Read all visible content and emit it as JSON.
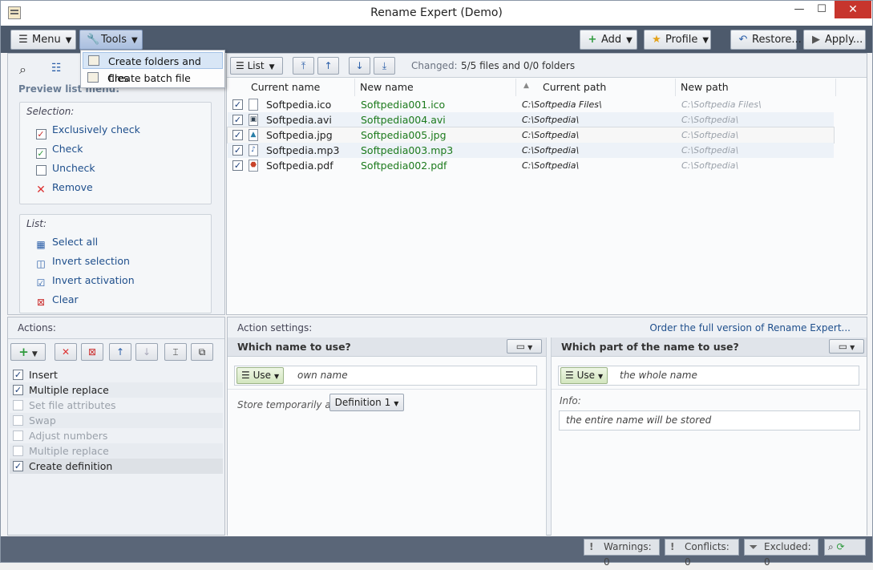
{
  "window": {
    "title": "Rename Expert (Demo)",
    "minimize": "—",
    "maximize": "☐",
    "close": "✕"
  },
  "toolbar": {
    "menu": "Menu",
    "tools": "Tools",
    "add": "Add",
    "profile": "Profile",
    "restore": "Restore...",
    "apply": "Apply..."
  },
  "tools_menu": {
    "items": [
      "Create folders and files",
      "Create batch file"
    ]
  },
  "sidebar": {
    "search_title": "Preview list menu:",
    "selection_label": "Selection:",
    "selection": [
      "Exclusively check",
      "Check",
      "Uncheck",
      "Remove"
    ],
    "list_label": "List:",
    "list": [
      "Select all",
      "Invert selection",
      "Invert activation",
      "Clear"
    ]
  },
  "preview": {
    "view": "List",
    "changed_label": "Changed:",
    "changed_value": "5/5 files and 0/0 folders",
    "columns": [
      "Current name",
      "New name",
      "Current path",
      "New path"
    ],
    "rows": [
      {
        "current": "Softpedia.ico",
        "new": "Softpedia001.ico",
        "path": "C:\\Softpedia Files\\",
        "new_path": "C:\\Softpedia Files\\",
        "icon": "file-icon"
      },
      {
        "current": "Softpedia.avi",
        "new": "Softpedia004.avi",
        "path": "C:\\Softpedia\\",
        "new_path": "C:\\Softpedia\\",
        "icon": "video-icon"
      },
      {
        "current": "Softpedia.jpg",
        "new": "Softpedia005.jpg",
        "path": "C:\\Softpedia\\",
        "new_path": "C:\\Softpedia\\",
        "icon": "image-icon"
      },
      {
        "current": "Softpedia.mp3",
        "new": "Softpedia003.mp3",
        "path": "C:\\Softpedia\\",
        "new_path": "C:\\Softpedia\\",
        "icon": "audio-icon"
      },
      {
        "current": "Softpedia.pdf",
        "new": "Softpedia002.pdf",
        "path": "C:\\Softpedia\\",
        "new_path": "C:\\Softpedia\\",
        "icon": "pdf-icon"
      }
    ]
  },
  "actions": {
    "title": "Actions:",
    "items": [
      {
        "label": "Insert",
        "checked": true,
        "enabled": true
      },
      {
        "label": "Multiple replace",
        "checked": true,
        "enabled": true
      },
      {
        "label": "Set file attributes",
        "checked": false,
        "enabled": false
      },
      {
        "label": "Swap",
        "checked": false,
        "enabled": false
      },
      {
        "label": "Adjust numbers",
        "checked": false,
        "enabled": false
      },
      {
        "label": "Multiple replace",
        "checked": false,
        "enabled": false
      },
      {
        "label": "Create definition",
        "checked": true,
        "enabled": true
      }
    ]
  },
  "settings": {
    "title": "Action settings:",
    "order_link": "Order the full version of Rename Expert...",
    "left": {
      "header": "Which name to use?",
      "use": "Use",
      "value": "own name",
      "store_label": "Store temporarily as:",
      "store_value": "Definition  1"
    },
    "right": {
      "header": "Which part of the name to use?",
      "use": "Use",
      "value": "the whole name",
      "info_label": "Info:",
      "info_value": "the entire name will be stored"
    }
  },
  "status": {
    "warnings": "Warnings: 0",
    "conflicts": "Conflicts: 0",
    "excluded": "Excluded: 0"
  }
}
